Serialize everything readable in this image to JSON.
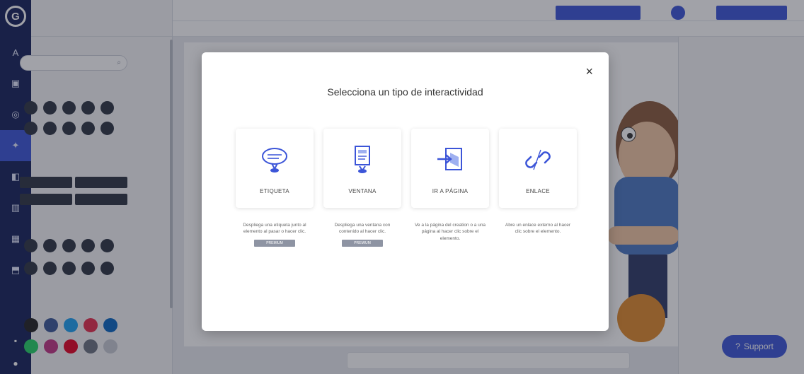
{
  "modal": {
    "title": "Selecciona un tipo de interactividad",
    "close_icon": "×",
    "options": [
      {
        "label": "ETIQUETA",
        "icon": "speech-bubble-icon",
        "description": "Despliega una etiqueta junto al elemento al pasar o hacer clic.",
        "badge": "PREMIUM"
      },
      {
        "label": "VENTANA",
        "icon": "window-icon",
        "description": "Despliega una ventana con contenido al hacer clic.",
        "badge": "PREMIUM"
      },
      {
        "label": "IR A PÁGINA",
        "icon": "go-to-page-icon",
        "description": "Ve a la página del creation o a una página al hacer clic sobre el elemento."
      },
      {
        "label": "ENLACE",
        "icon": "link-icon",
        "description": "Abre un enlace externo al hacer clic sobre el elemento."
      }
    ]
  },
  "support": {
    "label": "Support",
    "icon": "help-circle-icon"
  },
  "colors": {
    "accent": "#3c55d8",
    "rail": "#15215a",
    "overlay": "rgba(30,34,48,0.42)"
  }
}
